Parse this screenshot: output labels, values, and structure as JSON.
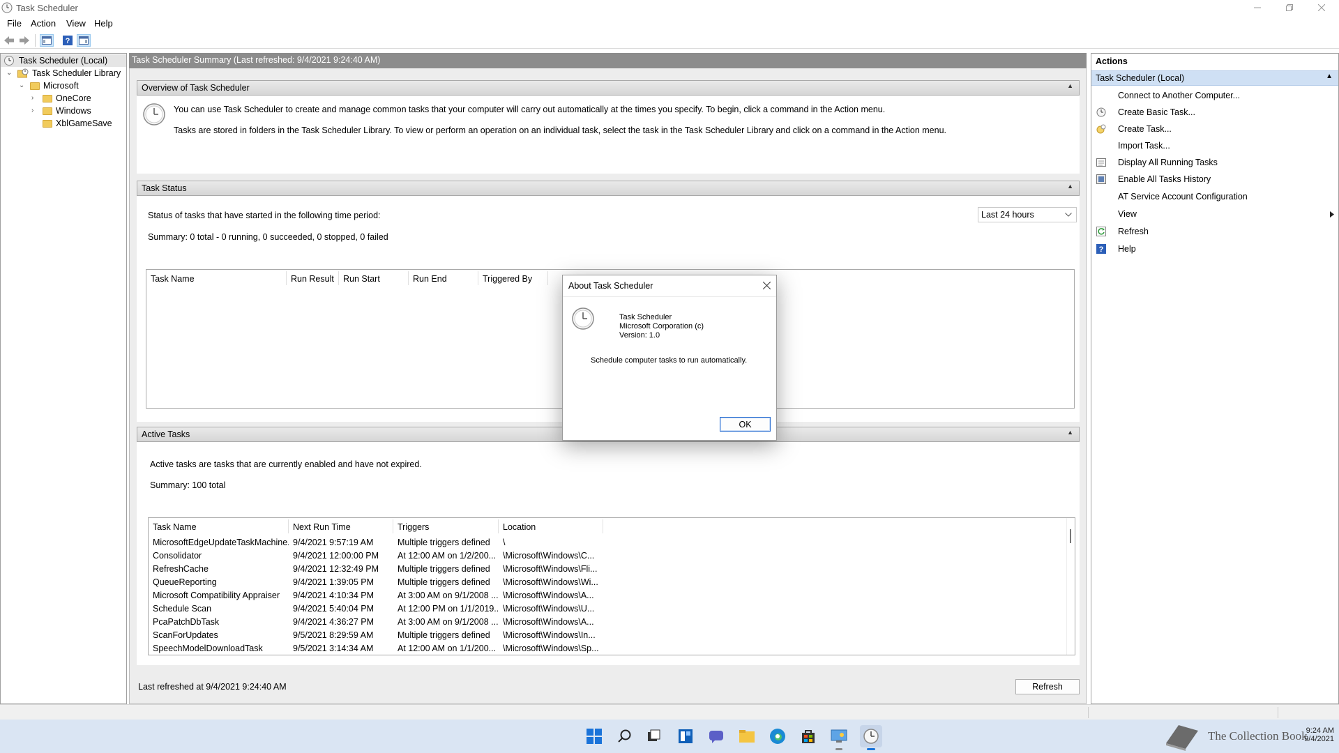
{
  "window": {
    "title": "Task Scheduler",
    "minimize_icon": "minimize-icon",
    "maximize_icon": "restore-icon",
    "close_icon": "close-icon"
  },
  "menu": [
    "File",
    "Action",
    "View",
    "Help"
  ],
  "toolbar": {
    "icons": [
      "back-arrow-icon",
      "forward-arrow-icon",
      "show-hide-console-tree-icon",
      "help-icon",
      "show-hide-action-pane-icon"
    ]
  },
  "tree": {
    "items": [
      {
        "label": "Task Scheduler (Local)",
        "icon": "clock-icon"
      },
      {
        "label": "Task Scheduler Library",
        "icon": "library-folder-icon"
      },
      {
        "label": "Microsoft",
        "icon": "folder-icon"
      },
      {
        "label": "OneCore",
        "icon": "folder-icon"
      },
      {
        "label": "Windows",
        "icon": "folder-icon"
      },
      {
        "label": "XblGameSave",
        "icon": "folder-icon"
      }
    ]
  },
  "center": {
    "header": "Task Scheduler Summary (Last refreshed: 9/4/2021 9:24:40 AM)",
    "overview": {
      "title": "Overview of Task Scheduler",
      "line1": "You can use Task Scheduler to create and manage common tasks that your computer will carry out automatically at the times you specify. To begin, click a command in the Action menu.",
      "line2": "Tasks are stored in folders in the Task Scheduler Library. To view or perform an operation on an individual task, select the task in the Task Scheduler Library and click on a command in the Action menu."
    },
    "status": {
      "title": "Task Status",
      "period_label": "Status of tasks that have started in the following time period:",
      "period_value": "Last 24 hours",
      "summary": "Summary: 0 total - 0 running, 0 succeeded, 0 stopped, 0 failed",
      "columns": [
        "Task Name",
        "Run Result",
        "Run Start",
        "Run End",
        "Triggered By"
      ]
    },
    "active": {
      "title": "Active Tasks",
      "description": "Active tasks are tasks that are currently enabled and have not expired.",
      "summary": "Summary: 100 total",
      "columns": [
        "Task Name",
        "Next Run Time",
        "Triggers",
        "Location"
      ],
      "rows": [
        [
          "MicrosoftEdgeUpdateTaskMachine...",
          "9/4/2021 9:57:19 AM",
          "Multiple triggers defined",
          "\\"
        ],
        [
          "Consolidator",
          "9/4/2021 12:00:00 PM",
          "At 12:00 AM on 1/2/200...",
          "\\Microsoft\\Windows\\C..."
        ],
        [
          "RefreshCache",
          "9/4/2021 12:32:49 PM",
          "Multiple triggers defined",
          "\\Microsoft\\Windows\\Fli..."
        ],
        [
          "QueueReporting",
          "9/4/2021 1:39:05 PM",
          "Multiple triggers defined",
          "\\Microsoft\\Windows\\Wi..."
        ],
        [
          "Microsoft Compatibility Appraiser",
          "9/4/2021 4:10:34 PM",
          "At 3:00 AM on 9/1/2008 ...",
          "\\Microsoft\\Windows\\A..."
        ],
        [
          "Schedule Scan",
          "9/4/2021 5:40:04 PM",
          "At 12:00 PM on 1/1/2019...",
          "\\Microsoft\\Windows\\U..."
        ],
        [
          "PcaPatchDbTask",
          "9/4/2021 4:36:27 PM",
          "At 3:00 AM on 9/1/2008 ...",
          "\\Microsoft\\Windows\\A..."
        ],
        [
          "ScanForUpdates",
          "9/5/2021 8:29:59 AM",
          "Multiple triggers defined",
          "\\Microsoft\\Windows\\In..."
        ],
        [
          "SpeechModelDownloadTask",
          "9/5/2021 3:14:34 AM",
          "At 12:00 AM on 1/1/200...",
          "\\Microsoft\\Windows\\Sp..."
        ]
      ]
    },
    "footer": {
      "last_refreshed": "Last refreshed at 9/4/2021 9:24:40 AM",
      "refresh_button": "Refresh"
    }
  },
  "actions": {
    "title": "Actions",
    "group": "Task Scheduler (Local)",
    "items": [
      {
        "label": "Connect to Another Computer...",
        "icon": ""
      },
      {
        "label": "Create Basic Task...",
        "icon": "create-basic-task-icon"
      },
      {
        "label": "Create Task...",
        "icon": "create-task-icon"
      },
      {
        "label": "Import Task...",
        "icon": ""
      },
      {
        "label": "Display All Running Tasks",
        "icon": "running-tasks-icon"
      },
      {
        "label": "Enable All Tasks History",
        "icon": "history-icon"
      },
      {
        "label": "AT Service Account Configuration",
        "icon": ""
      },
      {
        "label": "View",
        "icon": ""
      },
      {
        "label": "Refresh",
        "icon": "refresh-icon"
      },
      {
        "label": "Help",
        "icon": "help-icon"
      }
    ]
  },
  "dialog": {
    "title": "About Task Scheduler",
    "product": "Task Scheduler",
    "company": "Microsoft Corporation (c)",
    "version": "Version: 1.0",
    "description": "Schedule computer tasks to run automatically.",
    "ok_button": "OK"
  },
  "taskbar": {
    "icons": [
      "start-icon",
      "search-icon",
      "task-view-icon",
      "widgets-icon",
      "chat-icon",
      "file-explorer-icon",
      "edge-icon",
      "store-icon",
      "control-panel-icon",
      "task-scheduler-icon"
    ],
    "watermark": "The Collection Book",
    "time": "9:24 AM",
    "date": "9/4/2021"
  },
  "colors": {
    "accent_selection": "#cce4f7",
    "header_gray": "#8c8c8c",
    "taskbar": "#dae5f3",
    "folder": "#f1cb5c"
  }
}
